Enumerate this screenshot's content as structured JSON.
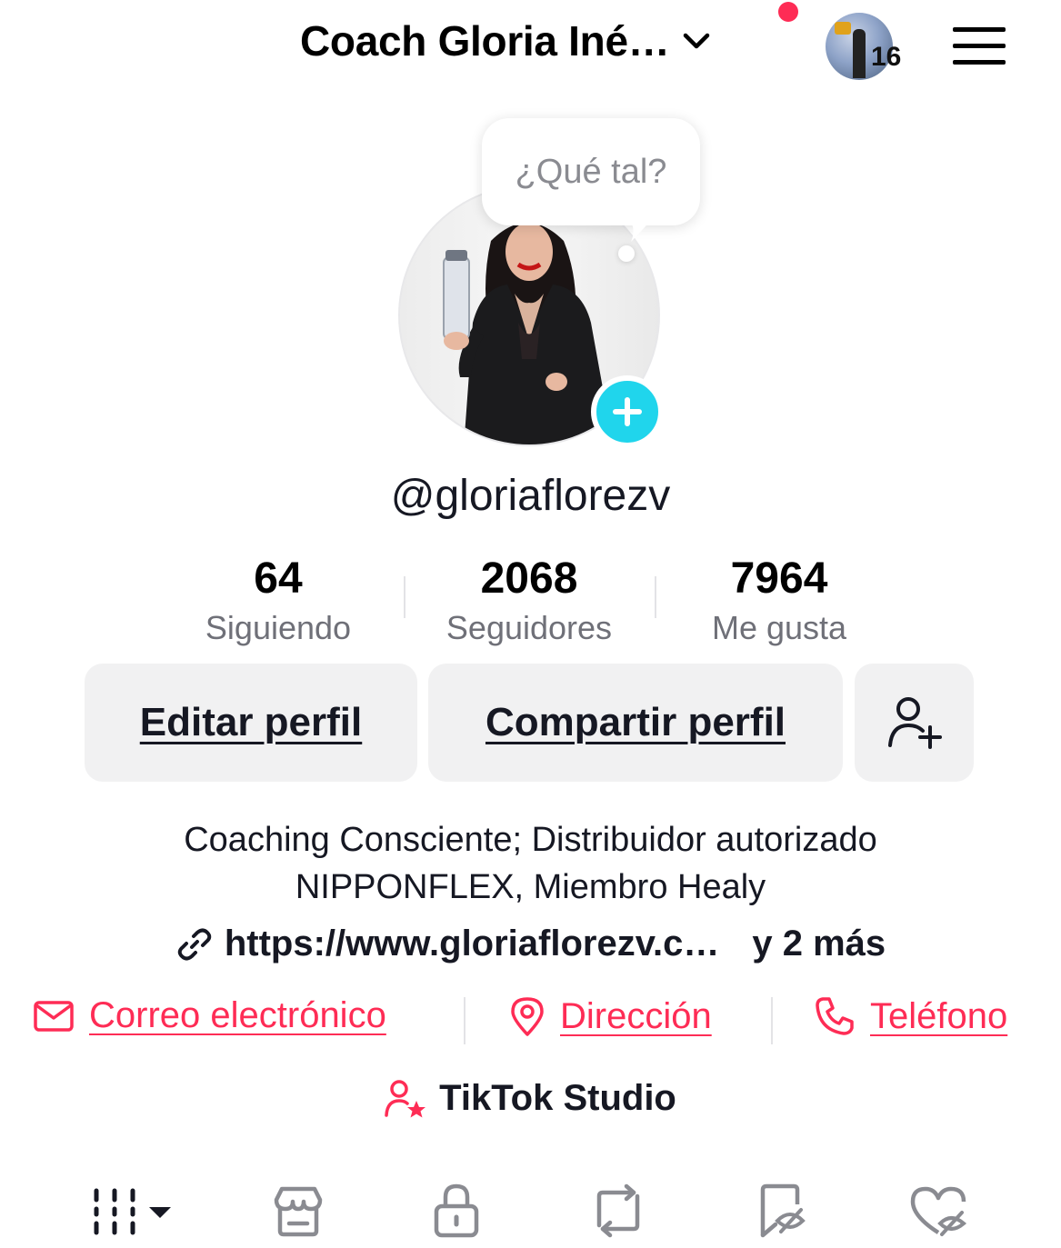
{
  "header": {
    "account_name": "Coach Gloria Iné…",
    "story_count": "16",
    "notification_color": "#fe2c55"
  },
  "bubble": {
    "text": "¿Qué tal?"
  },
  "profile": {
    "username": "@gloriaflorezv"
  },
  "stats": [
    {
      "value": "64",
      "label": "Siguiendo"
    },
    {
      "value": "2068",
      "label": "Seguidores"
    },
    {
      "value": "7964",
      "label": "Me gusta"
    }
  ],
  "buttons": {
    "edit": "Editar perfil",
    "share": "Compartir perfil"
  },
  "bio": {
    "line1": "Coaching Consciente; Distribuidor autorizado",
    "line2": "NIPPONFLEX, Miembro Healy"
  },
  "link": {
    "url": "https://www.gloriaflorezv.c…",
    "more": "y 2 más"
  },
  "contacts": {
    "email": "Correo electrónico",
    "address": "Dirección",
    "phone": "Teléfono"
  },
  "studio": {
    "label": "TikTok Studio"
  },
  "colors": {
    "accent": "#fe2c55",
    "add_button": "#20d5ec",
    "button_bg": "#f1f1f2"
  },
  "icons": [
    "chevron-down-icon",
    "menu-icon",
    "plus-icon",
    "add-friend-icon",
    "link-icon",
    "mail-icon",
    "location-icon",
    "phone-icon",
    "creator-star-icon",
    "grid-icon",
    "shop-icon",
    "lock-icon",
    "repost-icon",
    "favorites-hidden-icon",
    "liked-hidden-icon"
  ]
}
